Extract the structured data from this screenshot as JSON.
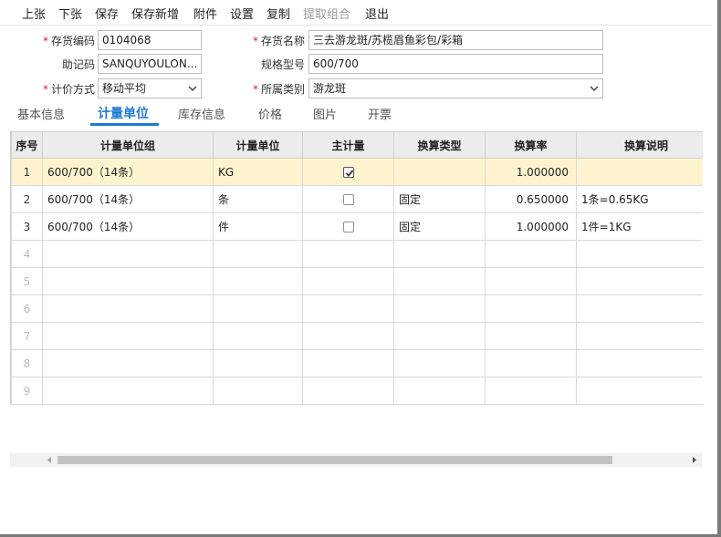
{
  "toolbar": {
    "items": [
      {
        "label": "上张",
        "disabled": false
      },
      {
        "label": "下张",
        "disabled": false
      },
      {
        "label": "保存",
        "disabled": false
      },
      {
        "label": "保存新增",
        "disabled": false
      },
      {
        "label": "附件",
        "disabled": false
      },
      {
        "label": "设置",
        "disabled": false
      },
      {
        "label": "复制",
        "disabled": false
      },
      {
        "label": "提取组合",
        "disabled": true
      },
      {
        "label": "退出",
        "disabled": false
      }
    ]
  },
  "form": {
    "code": {
      "label": "存货编码",
      "required": "*",
      "value": "0104068"
    },
    "name": {
      "label": "存货名称",
      "required": "*",
      "value": "三去游龙斑/苏榄眉鱼彩包/彩箱"
    },
    "mnemonic": {
      "label": "助记码",
      "value": "SANQUYOULON..."
    },
    "spec": {
      "label": "规格型号",
      "value": "600/700"
    },
    "valuation": {
      "label": "计价方式",
      "required": "*",
      "value": "移动平均"
    },
    "category": {
      "label": "所属类别",
      "required": "*",
      "value": "游龙斑"
    }
  },
  "tabs": [
    {
      "label": "基本信息",
      "active": false
    },
    {
      "label": "计量单位",
      "active": true
    },
    {
      "label": "库存信息",
      "active": false
    },
    {
      "label": "价格",
      "active": false
    },
    {
      "label": "图片",
      "active": false
    },
    {
      "label": "开票",
      "active": false
    }
  ],
  "grid": {
    "columns": [
      "序号",
      "计量单位组",
      "计量单位",
      "主计量",
      "换算类型",
      "换算率",
      "换算说明"
    ],
    "rows": [
      {
        "no": "1",
        "group": "600/700（14条）",
        "unit": "KG",
        "main": true,
        "conv_type": "",
        "rate": "1.000000",
        "desc": ""
      },
      {
        "no": "2",
        "group": "600/700（14条）",
        "unit": "条",
        "main": false,
        "conv_type": "固定",
        "rate": "0.650000",
        "desc": "1条=0.65KG"
      },
      {
        "no": "3",
        "group": "600/700（14条）",
        "unit": "件",
        "main": false,
        "conv_type": "固定",
        "rate": "1.000000",
        "desc": "1件=1KG"
      }
    ],
    "empty_rows": [
      "4",
      "5",
      "6",
      "7",
      "8",
      "9"
    ]
  }
}
